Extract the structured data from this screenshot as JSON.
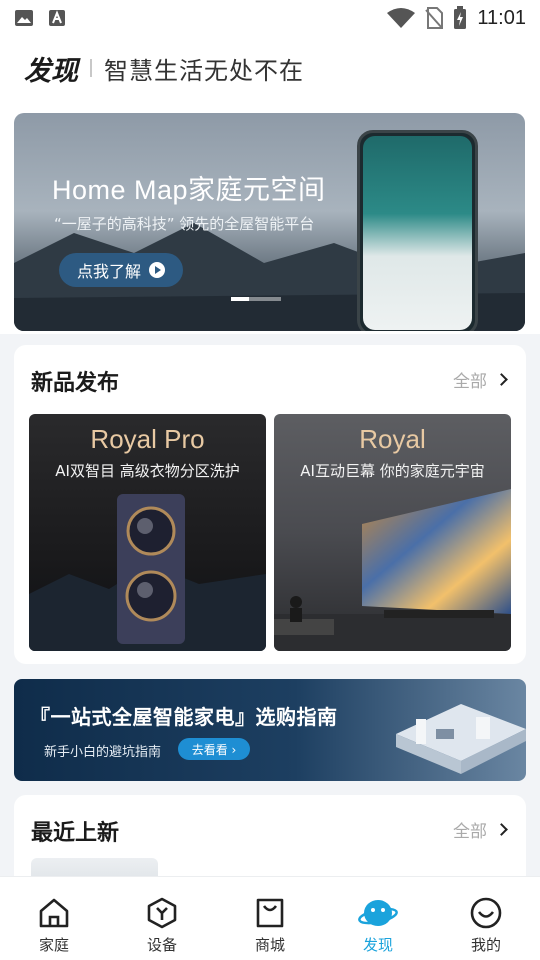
{
  "status_bar": {
    "time": "11:01"
  },
  "header": {
    "brand": "发现",
    "slogan": "智慧生活无处不在"
  },
  "banner": {
    "title": "Home Map家庭元空间",
    "subtitle": "“一屋子的高科技” 领先的全屋智能平台",
    "button": "点我了解"
  },
  "new_products": {
    "title": "新品发布",
    "more": "全部",
    "items": [
      {
        "name": "Royal Pro",
        "desc": "AI双智目 高级衣物分区洗护"
      },
      {
        "name": "Royal",
        "desc": "AI互动巨幕 你的家庭元宇宙"
      }
    ]
  },
  "guide": {
    "title": "『一站式全屋智能家电』选购指南",
    "subtitle": "新手小白的避坑指南",
    "button": "去看看 ›"
  },
  "recent": {
    "title": "最近上新",
    "more": "全部"
  },
  "tabs": [
    {
      "label": "家庭",
      "icon": "home-icon"
    },
    {
      "label": "设备",
      "icon": "device-icon"
    },
    {
      "label": "商城",
      "icon": "shopping-bag-icon"
    },
    {
      "label": "发现",
      "icon": "discover-icon"
    },
    {
      "label": "我的",
      "icon": "profile-icon"
    }
  ],
  "colors": {
    "accent": "#1aa3dc",
    "guide_button": "#1e8ed3"
  }
}
